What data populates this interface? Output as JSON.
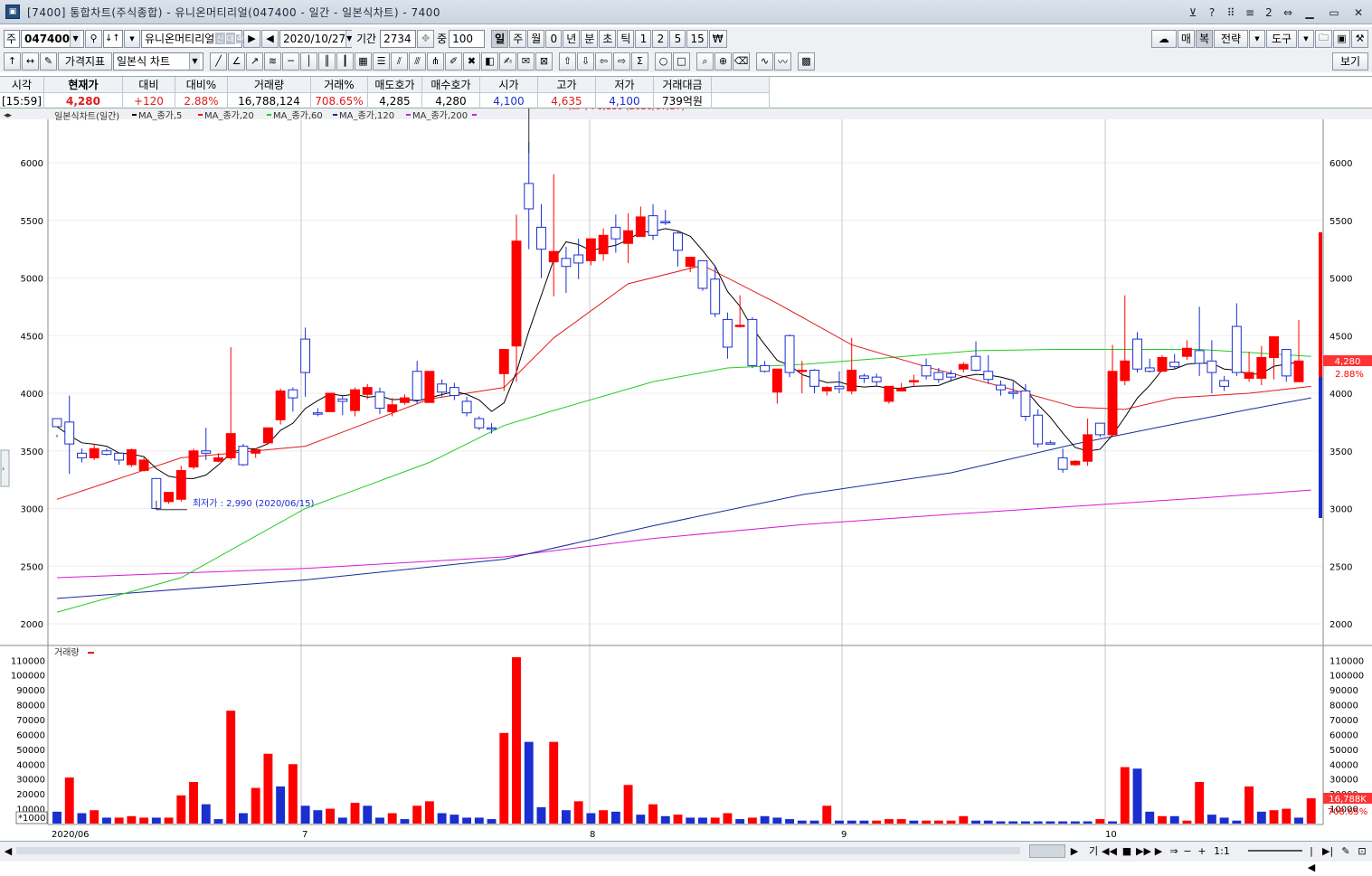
{
  "window": {
    "title": "[7400] 통합차트(주식종합) - 유니온머티리얼(047400 - 일간 - 일본식차트) - 7400",
    "ctrl_icons": [
      "pin-icon",
      "help-icon",
      "collapse-icon",
      "layout-icon",
      "2",
      "restore-icon"
    ]
  },
  "toolbar": {
    "market": "주",
    "code": "047400",
    "dir_icon": "↓↑",
    "stock_name": "유니온머티리얼",
    "chip1": "신",
    "chip2": "대",
    "chip3": "40",
    "date": "2020/10/27",
    "period_label": "기간",
    "period_value": "2734",
    "count_label": "중",
    "count_value": "100",
    "periods": [
      "일",
      "주",
      "월",
      "0",
      "년",
      "분",
      "초",
      "틱",
      "1",
      "2",
      "5",
      "15",
      "₩"
    ],
    "active_period": "일",
    "right": {
      "cloud_icon": "cloud-icon",
      "btn1": "매",
      "btn2": "복",
      "btn3": "전략",
      "btn4": "도구"
    },
    "indicator_btn": "가격지표",
    "chart_type": "일본식 차트",
    "view_btn": "보기"
  },
  "quote": {
    "headers": [
      "시각",
      "현재가",
      "대비",
      "대비%",
      "거래량",
      "거래%",
      "매도호가",
      "매수호가",
      "시가",
      "고가",
      "저가",
      "거래대금"
    ],
    "values": [
      "[15:59]",
      "4,280",
      "+120",
      "2.88%",
      "16,788,124",
      "708.65%",
      "4,285",
      "4,280",
      "4,100",
      "4,635",
      "4,100",
      "739억원"
    ]
  },
  "chart": {
    "legend_main": "일본식차트(일간)",
    "ma_legends": [
      "MA_종가,5",
      "MA_종가,20",
      "MA_종가,60",
      "MA_종가,120",
      "MA_종가,200"
    ],
    "legend_volume": "거래량",
    "high_label": "최고가 : 6,180 (2020/07/27)",
    "low_label": "최저가 : 2,990 (2020/06/15)",
    "price_tag": "4,280",
    "pct_tag": "2.88%",
    "vol_tag": "16,788K",
    "vol_pct_tag": "708.65%",
    "vol_unit": "*1000",
    "x_labels": [
      "2020/06",
      "7",
      "8",
      "9",
      "10"
    ],
    "colors": {
      "up": "#ff0000",
      "down": "#1a2fcf",
      "ma5": "#000000",
      "ma20": "#e01b1b",
      "ma60": "#22cc22",
      "ma120": "#1a2a9c",
      "ma200": "#d61ad6",
      "grid": "#c8c8c8"
    }
  },
  "chart_data": {
    "type": "candlestick",
    "x_range": [
      "2020/06",
      "2020/10/27"
    ],
    "price_axis_ticks": [
      2000,
      2500,
      3000,
      3500,
      4000,
      4500,
      5000,
      5500,
      6000
    ],
    "volume_axis_ticks": [
      10000,
      20000,
      30000,
      40000,
      50000,
      60000,
      70000,
      80000,
      90000,
      100000,
      110000
    ],
    "highest": {
      "value": 6180,
      "date": "2020/07/27"
    },
    "lowest": {
      "value": 2990,
      "date": "2020/06/15"
    },
    "candles": [
      [
        3780,
        3710,
        3640,
        3620,
        "d"
      ],
      [
        3750,
        3560,
        3980,
        3300,
        "d"
      ],
      [
        3480,
        3440,
        3520,
        3400,
        "d"
      ],
      [
        3440,
        3520,
        3560,
        3420,
        "u"
      ],
      [
        3500,
        3470,
        3520,
        3460,
        "d"
      ],
      [
        3480,
        3420,
        3480,
        3380,
        "d"
      ],
      [
        3380,
        3510,
        3520,
        3360,
        "u"
      ],
      [
        3420,
        3330,
        3440,
        3320,
        "u"
      ],
      [
        3260,
        3000,
        3260,
        2990,
        "d"
      ],
      [
        3060,
        3140,
        3140,
        3040,
        "u"
      ],
      [
        3080,
        3330,
        3370,
        3060,
        "u"
      ],
      [
        3360,
        3500,
        3520,
        3340,
        "u"
      ],
      [
        3500,
        3480,
        3700,
        3420,
        "d"
      ],
      [
        3410,
        3440,
        3480,
        3400,
        "u"
      ],
      [
        3440,
        3650,
        4400,
        3420,
        "u"
      ],
      [
        3380,
        3540,
        3560,
        3370,
        "d"
      ],
      [
        3510,
        3480,
        3520,
        3440,
        "u"
      ],
      [
        3570,
        3700,
        3700,
        3570,
        "u"
      ],
      [
        3770,
        4020,
        4040,
        3730,
        "u"
      ],
      [
        4030,
        3960,
        4050,
        3840,
        "d"
      ],
      [
        4470,
        4180,
        4570,
        3970,
        "d"
      ],
      [
        3830,
        3820,
        3870,
        3800,
        "d"
      ],
      [
        3840,
        4000,
        4000,
        3860,
        "u"
      ],
      [
        3950,
        3930,
        3980,
        3810,
        "d"
      ],
      [
        3850,
        4030,
        4050,
        3800,
        "u"
      ],
      [
        3990,
        4050,
        4080,
        3950,
        "u"
      ],
      [
        4010,
        3870,
        4050,
        3820,
        "d"
      ],
      [
        3900,
        3840,
        3960,
        3800,
        "u"
      ],
      [
        3920,
        3960,
        3990,
        3900,
        "u"
      ],
      [
        4190,
        3940,
        4280,
        3910,
        "d"
      ],
      [
        3920,
        4190,
        4190,
        3970,
        "u"
      ],
      [
        4080,
        4010,
        4120,
        3970,
        "d"
      ],
      [
        4050,
        3980,
        4090,
        3940,
        "d"
      ],
      [
        3930,
        3830,
        3970,
        3800,
        "d"
      ],
      [
        3780,
        3700,
        3800,
        3680,
        "d"
      ],
      [
        3700,
        3690,
        3740,
        3650,
        "d"
      ],
      [
        4170,
        4380,
        4350,
        4020,
        "u"
      ],
      [
        4410,
        5320,
        5550,
        4100,
        "u"
      ],
      [
        5820,
        5600,
        6180,
        5250,
        "d"
      ],
      [
        5440,
        5250,
        5640,
        5000,
        "d"
      ],
      [
        5140,
        5230,
        5900,
        4840,
        "u"
      ],
      [
        5100,
        5170,
        5270,
        4870,
        "d"
      ],
      [
        5130,
        5200,
        5340,
        4990,
        "d"
      ],
      [
        5150,
        5340,
        5340,
        5110,
        "u"
      ],
      [
        5210,
        5370,
        5430,
        5150,
        "u"
      ],
      [
        5440,
        5340,
        5550,
        5220,
        "d"
      ],
      [
        5300,
        5410,
        5560,
        5130,
        "u"
      ],
      [
        5360,
        5530,
        5620,
        5380,
        "u"
      ],
      [
        5540,
        5370,
        5640,
        5330,
        "d"
      ],
      [
        5490,
        5490,
        5590,
        5460,
        "d"
      ],
      [
        5390,
        5240,
        5400,
        5100,
        "d"
      ],
      [
        5100,
        5180,
        5180,
        5050,
        "u"
      ],
      [
        5150,
        4910,
        5140,
        4890,
        "d"
      ],
      [
        4990,
        4690,
        5110,
        4660,
        "d"
      ],
      [
        4640,
        4400,
        4700,
        4300,
        "d"
      ],
      [
        4590,
        4590,
        4850,
        4570,
        "u"
      ],
      [
        4640,
        4240,
        4660,
        4220,
        "d"
      ],
      [
        4240,
        4190,
        4280,
        4180,
        "d"
      ],
      [
        4210,
        4010,
        4210,
        3910,
        "u"
      ],
      [
        4500,
        4180,
        4510,
        4140,
        "d"
      ],
      [
        4200,
        4190,
        4280,
        4000,
        "u"
      ],
      [
        4200,
        4060,
        4210,
        4000,
        "d"
      ],
      [
        4050,
        4020,
        4060,
        3980,
        "u"
      ],
      [
        4060,
        4040,
        4190,
        4000,
        "d"
      ],
      [
        4200,
        4020,
        4480,
        3990,
        "u"
      ],
      [
        4150,
        4130,
        4170,
        4090,
        "d"
      ],
      [
        4140,
        4100,
        4170,
        4060,
        "d"
      ],
      [
        4060,
        3930,
        4060,
        3910,
        "u"
      ],
      [
        4020,
        4040,
        4090,
        4020,
        "u"
      ],
      [
        4110,
        4100,
        4160,
        4060,
        "u"
      ],
      [
        4240,
        4150,
        4300,
        4120,
        "d"
      ],
      [
        4180,
        4120,
        4220,
        4090,
        "d"
      ],
      [
        4170,
        4140,
        4200,
        4100,
        "d"
      ],
      [
        4250,
        4210,
        4270,
        4180,
        "u"
      ],
      [
        4320,
        4200,
        4450,
        4190,
        "d"
      ],
      [
        4190,
        4120,
        4330,
        4080,
        "d"
      ],
      [
        4070,
        4030,
        4110,
        3980,
        "d"
      ],
      [
        4010,
        4000,
        4100,
        3950,
        "d"
      ],
      [
        4020,
        3800,
        4080,
        3760,
        "d"
      ],
      [
        3810,
        3560,
        3860,
        3530,
        "d"
      ],
      [
        3570,
        3570,
        3590,
        3560,
        "d"
      ],
      [
        3440,
        3340,
        3520,
        3310,
        "d"
      ],
      [
        3410,
        3380,
        3420,
        3370,
        "u"
      ],
      [
        3410,
        3640,
        3780,
        3370,
        "u"
      ],
      [
        3740,
        3640,
        3710,
        3620,
        "d"
      ],
      [
        3640,
        4190,
        4420,
        3620,
        "u"
      ],
      [
        4280,
        4110,
        4850,
        4070,
        "u"
      ],
      [
        4470,
        4210,
        4530,
        4180,
        "d"
      ],
      [
        4220,
        4190,
        4300,
        4180,
        "d"
      ],
      [
        4190,
        4310,
        4330,
        4190,
        "u"
      ],
      [
        4270,
        4230,
        4340,
        4210,
        "d"
      ],
      [
        4390,
        4320,
        4460,
        4290,
        "u"
      ],
      [
        4370,
        4260,
        4750,
        4150,
        "d"
      ],
      [
        4280,
        4180,
        4460,
        4000,
        "d"
      ],
      [
        4110,
        4060,
        4150,
        4020,
        "d"
      ],
      [
        4580,
        4180,
        4780,
        4150,
        "d"
      ],
      [
        4180,
        4130,
        4360,
        4100,
        "u"
      ],
      [
        4130,
        4310,
        4410,
        4070,
        "u"
      ],
      [
        4310,
        4490,
        4490,
        4120,
        "u"
      ],
      [
        4380,
        4150,
        4380,
        4100,
        "d"
      ],
      [
        4100,
        4280,
        4635,
        4100,
        "u"
      ]
    ],
    "volumes": [
      [
        8000,
        "d"
      ],
      [
        31000,
        "u"
      ],
      [
        7000,
        "d"
      ],
      [
        9000,
        "u"
      ],
      [
        4000,
        "d"
      ],
      [
        4000,
        "u"
      ],
      [
        5000,
        "u"
      ],
      [
        4000,
        "u"
      ],
      [
        4000,
        "d"
      ],
      [
        4000,
        "u"
      ],
      [
        19000,
        "u"
      ],
      [
        28000,
        "u"
      ],
      [
        13000,
        "d"
      ],
      [
        3000,
        "d"
      ],
      [
        76000,
        "u"
      ],
      [
        7000,
        "d"
      ],
      [
        24000,
        "u"
      ],
      [
        47000,
        "u"
      ],
      [
        25000,
        "d"
      ],
      [
        40000,
        "u"
      ],
      [
        12000,
        "d"
      ],
      [
        9000,
        "d"
      ],
      [
        10000,
        "u"
      ],
      [
        4000,
        "d"
      ],
      [
        14000,
        "u"
      ],
      [
        12000,
        "d"
      ],
      [
        4000,
        "d"
      ],
      [
        7000,
        "u"
      ],
      [
        3000,
        "d"
      ],
      [
        12000,
        "u"
      ],
      [
        15000,
        "u"
      ],
      [
        7000,
        "d"
      ],
      [
        6000,
        "d"
      ],
      [
        4000,
        "d"
      ],
      [
        4000,
        "d"
      ],
      [
        3000,
        "d"
      ],
      [
        61000,
        "u"
      ],
      [
        112000,
        "u"
      ],
      [
        55000,
        "d"
      ],
      [
        11000,
        "d"
      ],
      [
        55000,
        "u"
      ],
      [
        9000,
        "d"
      ],
      [
        15000,
        "u"
      ],
      [
        7000,
        "d"
      ],
      [
        9000,
        "u"
      ],
      [
        8000,
        "d"
      ],
      [
        26000,
        "u"
      ],
      [
        6000,
        "d"
      ],
      [
        13000,
        "u"
      ],
      [
        5000,
        "d"
      ],
      [
        6000,
        "u"
      ],
      [
        4000,
        "d"
      ],
      [
        4000,
        "d"
      ],
      [
        4000,
        "u"
      ],
      [
        7000,
        "u"
      ],
      [
        3000,
        "d"
      ],
      [
        4000,
        "u"
      ],
      [
        5000,
        "d"
      ],
      [
        4000,
        "d"
      ],
      [
        3000,
        "d"
      ],
      [
        2000,
        "d"
      ],
      [
        2000,
        "d"
      ],
      [
        12000,
        "u"
      ],
      [
        2000,
        "d"
      ],
      [
        2000,
        "d"
      ],
      [
        2000,
        "d"
      ],
      [
        2000,
        "u"
      ],
      [
        3000,
        "u"
      ],
      [
        3000,
        "u"
      ],
      [
        2000,
        "d"
      ],
      [
        2000,
        "u"
      ],
      [
        2000,
        "u"
      ],
      [
        2000,
        "u"
      ],
      [
        5000,
        "u"
      ],
      [
        2000,
        "d"
      ],
      [
        2000,
        "d"
      ],
      [
        1500,
        "d"
      ],
      [
        1500,
        "d"
      ],
      [
        1500,
        "d"
      ],
      [
        1500,
        "d"
      ],
      [
        1500,
        "d"
      ],
      [
        1500,
        "d"
      ],
      [
        1500,
        "d"
      ],
      [
        1500,
        "d"
      ],
      [
        3000,
        "u"
      ],
      [
        1500,
        "d"
      ],
      [
        38000,
        "u"
      ],
      [
        37000,
        "d"
      ],
      [
        8000,
        "d"
      ],
      [
        5000,
        "u"
      ],
      [
        5000,
        "d"
      ],
      [
        2000,
        "u"
      ],
      [
        28000,
        "u"
      ],
      [
        6000,
        "d"
      ],
      [
        4000,
        "d"
      ],
      [
        2000,
        "d"
      ],
      [
        25000,
        "u"
      ],
      [
        8000,
        "d"
      ],
      [
        9000,
        "u"
      ],
      [
        10000,
        "u"
      ],
      [
        4000,
        "d"
      ],
      [
        17000,
        "u"
      ]
    ],
    "ma20": [
      [
        0,
        3080
      ],
      [
        10,
        3440
      ],
      [
        20,
        3540
      ],
      [
        30,
        3950
      ],
      [
        36,
        4050
      ],
      [
        40,
        4480
      ],
      [
        46,
        4950
      ],
      [
        52,
        5110
      ],
      [
        58,
        4780
      ],
      [
        64,
        4420
      ],
      [
        70,
        4230
      ],
      [
        76,
        4060
      ],
      [
        82,
        3880
      ],
      [
        86,
        3860
      ],
      [
        90,
        3960
      ],
      [
        96,
        4000
      ],
      [
        101,
        4060
      ]
    ],
    "ma60": [
      [
        0,
        2100
      ],
      [
        10,
        2400
      ],
      [
        20,
        3000
      ],
      [
        30,
        3400
      ],
      [
        36,
        3720
      ],
      [
        40,
        3850
      ],
      [
        48,
        4100
      ],
      [
        54,
        4220
      ],
      [
        60,
        4250
      ],
      [
        66,
        4300
      ],
      [
        74,
        4370
      ],
      [
        80,
        4380
      ],
      [
        86,
        4380
      ],
      [
        92,
        4380
      ],
      [
        101,
        4320
      ]
    ],
    "ma120": [
      [
        0,
        2220
      ],
      [
        20,
        2380
      ],
      [
        36,
        2560
      ],
      [
        48,
        2850
      ],
      [
        60,
        3120
      ],
      [
        72,
        3310
      ],
      [
        82,
        3560
      ],
      [
        88,
        3690
      ],
      [
        96,
        3860
      ],
      [
        101,
        3960
      ]
    ],
    "ma200": [
      [
        0,
        2400
      ],
      [
        20,
        2480
      ],
      [
        36,
        2580
      ],
      [
        48,
        2740
      ],
      [
        60,
        2860
      ],
      [
        72,
        2950
      ],
      [
        82,
        3020
      ],
      [
        92,
        3090
      ],
      [
        101,
        3160
      ]
    ]
  }
}
